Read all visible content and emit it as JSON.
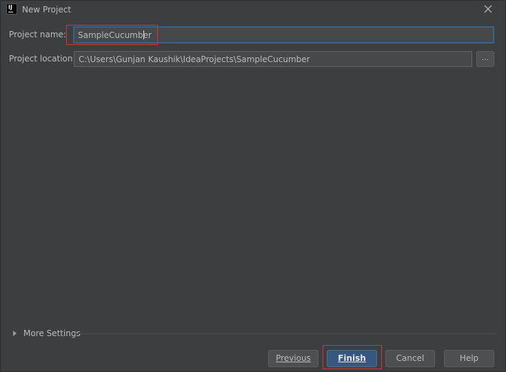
{
  "window": {
    "title": "New Project",
    "icon": "intellij-idea-icon",
    "icon_text": "IJ"
  },
  "form": {
    "project_name": {
      "label": "Project name:",
      "value": "SampleCucumber"
    },
    "project_location": {
      "label": "Project location:",
      "value": "C:\\Users\\Gunjan Kaushik\\IdeaProjects\\SampleCucumber",
      "browse_label": "..."
    }
  },
  "more_settings": {
    "label": "More Settings",
    "expanded": false
  },
  "buttons": {
    "previous": "Previous",
    "finish": "Finish",
    "cancel": "Cancel",
    "help": "Help"
  },
  "colors": {
    "background": "#3c3f41",
    "input_background": "#45494a",
    "focus_border": "#3d6185",
    "default_button": "#365880",
    "annotation_red": "#e0303a"
  }
}
